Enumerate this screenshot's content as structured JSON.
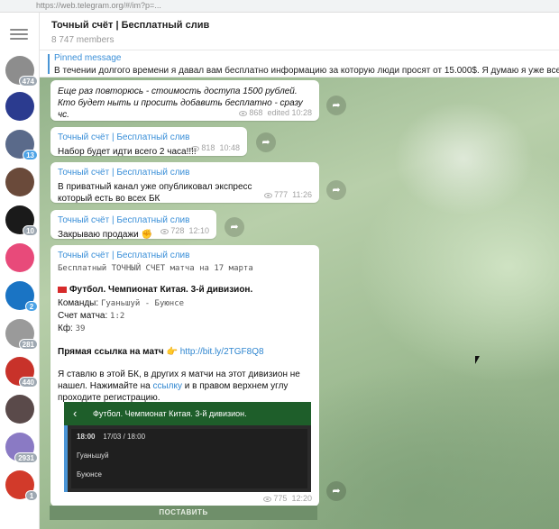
{
  "browser": {
    "url": "https://web.telegram.org/#/im?p=..."
  },
  "sidebar": {
    "chats": [
      {
        "badge": "474",
        "color": "#8d8d8d",
        "icon": "camera-icon"
      },
      {
        "badge": "",
        "color": "#2b3b8f",
        "icon": "globe-icon"
      },
      {
        "badge": "13",
        "color": "#5a6a8a",
        "icon": "person-icon"
      },
      {
        "badge": "",
        "color": "#6a4a3a",
        "icon": "group-icon"
      },
      {
        "badge": "10",
        "color": "#1a1a1a",
        "icon": "skull-icon"
      },
      {
        "badge": "",
        "color": "#e84a7a",
        "icon": "logo-icon"
      },
      {
        "badge": "2",
        "color": "#1a74c4",
        "icon": "atp-icon"
      },
      {
        "badge": "281",
        "color": "#9a9a9a",
        "icon": "pen-icon"
      },
      {
        "badge": "440",
        "color": "#c8322a",
        "icon": "ball-icon"
      },
      {
        "badge": "",
        "color": "#5a4a4a",
        "icon": "person-icon"
      },
      {
        "badge": "2931",
        "color": "#8a7ac4",
        "icon": "fb-icon"
      },
      {
        "badge": "1",
        "color": "#d23a2a",
        "icon": "logo-icon"
      }
    ]
  },
  "header": {
    "title": "Точный счёт | Бесплатный слив",
    "members": "8 747 members"
  },
  "pinned": {
    "label": "Pinned message",
    "text": "В течении долгого времени я давал вам бесплатно информацию за которую люди просят от 15.000$. Я думаю я уже всем доказал"
  },
  "messages": [
    {
      "author": "",
      "text": "Еще раз повторюсь - стоимость доступа 1500 рублей. Кто будет ныть и просить добавить бесплатно - сразу чс.",
      "views": "868",
      "time": "edited 10:28"
    },
    {
      "author": "Точный счёт | Бесплатный слив",
      "text": "Набор будет идти всего 2 часа!!!!",
      "views": "818",
      "time": "10:48"
    },
    {
      "author": "Точный счёт | Бесплатный слив",
      "text": "В приватный канал уже опубликовал экспресс который есть во всех БК",
      "views": "777",
      "time": "11:26"
    },
    {
      "author": "Точный счёт | Бесплатный слив",
      "text": "Закрываю продажи ✊",
      "views": "728",
      "time": "12:10"
    }
  ],
  "main_post": {
    "author": "Точный счёт | Бесплатный слив",
    "subtitle": "Бесплатный ТОЧНЫЙ СЧЕТ матча на 17 марта",
    "sport": "Футбол. Чемпионат Китая. 3-й дивизион.",
    "teams_label": "Команды:",
    "teams_value": "Гуаньшуй - Буюнсе",
    "score_label": "Счет матча:",
    "score_value": "1:2",
    "odds_label": "Кф:",
    "odds_value": "39",
    "link_label": "Прямая ссылка на матч",
    "link_url": "http://bit.ly/2TGF8Q8",
    "text_part1": "Я ставлю в этой БК, в других я матчи на этот дивизион не нашел. Нажимайте на ",
    "text_link": "ссылку",
    "text_part2": " и в правом верхнем углу проходите регистрацию.",
    "preview_title": "Футбол. Чемпионат Китая. 3-й дивизион.",
    "preview_time": "18:00",
    "preview_date": "17/03 / 18:00",
    "preview_team1": "Гуаньшуй",
    "preview_team2": "Буюнсе",
    "views": "775",
    "time": "12:20",
    "button_label": "ПОСТАВИТЬ"
  }
}
